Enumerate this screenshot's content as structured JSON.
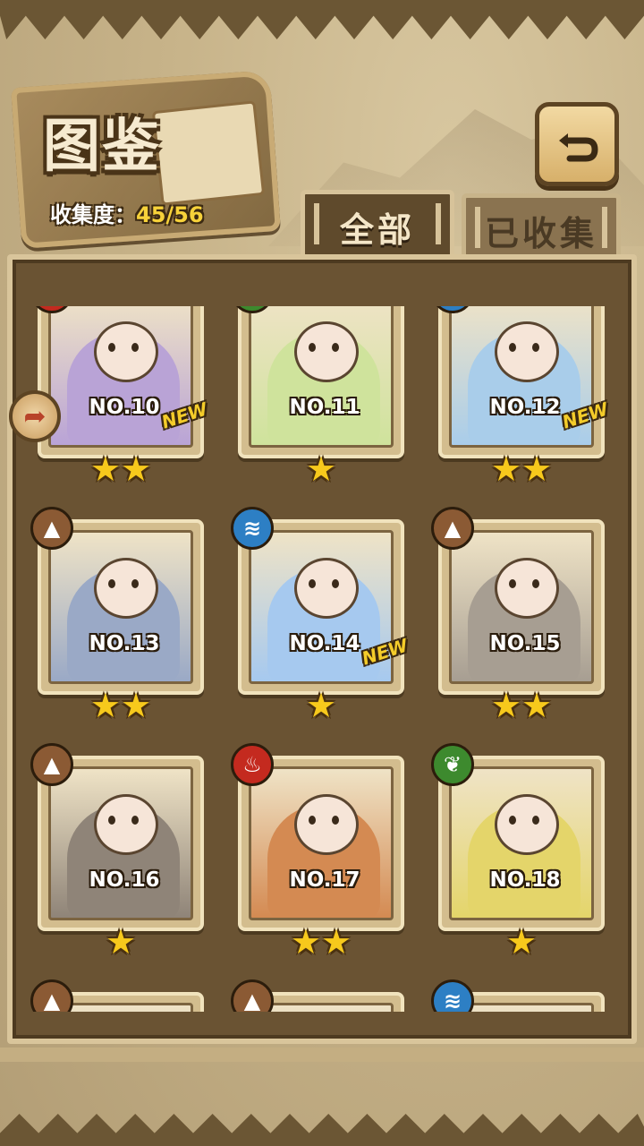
{
  "header": {
    "title": "图鉴",
    "collection_label": "收集度：",
    "collection_value": "45/56"
  },
  "tabs": [
    {
      "label": "全部",
      "active": true
    },
    {
      "label": "已收集",
      "active": false
    }
  ],
  "cards": [
    {
      "number": "NO.10",
      "element": "fire",
      "stars": "★★",
      "new": "NEW",
      "color": "#b9a3d6"
    },
    {
      "number": "NO.11",
      "element": "leaf",
      "stars": "★",
      "new": "",
      "color": "#cfe39c"
    },
    {
      "number": "NO.12",
      "element": "water",
      "stars": "★★",
      "new": "NEW",
      "color": "#a9cdea"
    },
    {
      "number": "NO.13",
      "element": "earth",
      "stars": "★★",
      "new": "",
      "color": "#9aa9c6"
    },
    {
      "number": "NO.14",
      "element": "water",
      "stars": "★",
      "new": "NEW",
      "color": "#a6c9ef"
    },
    {
      "number": "NO.15",
      "element": "earth",
      "stars": "★★",
      "new": "",
      "color": "#a79e92"
    },
    {
      "number": "NO.16",
      "element": "earth",
      "stars": "★",
      "new": "",
      "color": "#8f8478"
    },
    {
      "number": "NO.17",
      "element": "fire",
      "stars": "★★",
      "new": "",
      "color": "#d48a52"
    },
    {
      "number": "NO.18",
      "element": "leaf",
      "stars": "★",
      "new": "",
      "color": "#e4d56a"
    },
    {
      "number": "",
      "element": "earth",
      "stars": "",
      "new": "",
      "color": "#a99d84"
    },
    {
      "number": "",
      "element": "earth",
      "stars": "",
      "new": "",
      "color": "#a99d84"
    },
    {
      "number": "",
      "element": "water",
      "stars": "",
      "new": "",
      "color": "#a99d84"
    }
  ],
  "element_icons": {
    "fire": "flame-icon",
    "leaf": "leaf-icon",
    "water": "water-icon",
    "earth": "mountain-icon"
  }
}
